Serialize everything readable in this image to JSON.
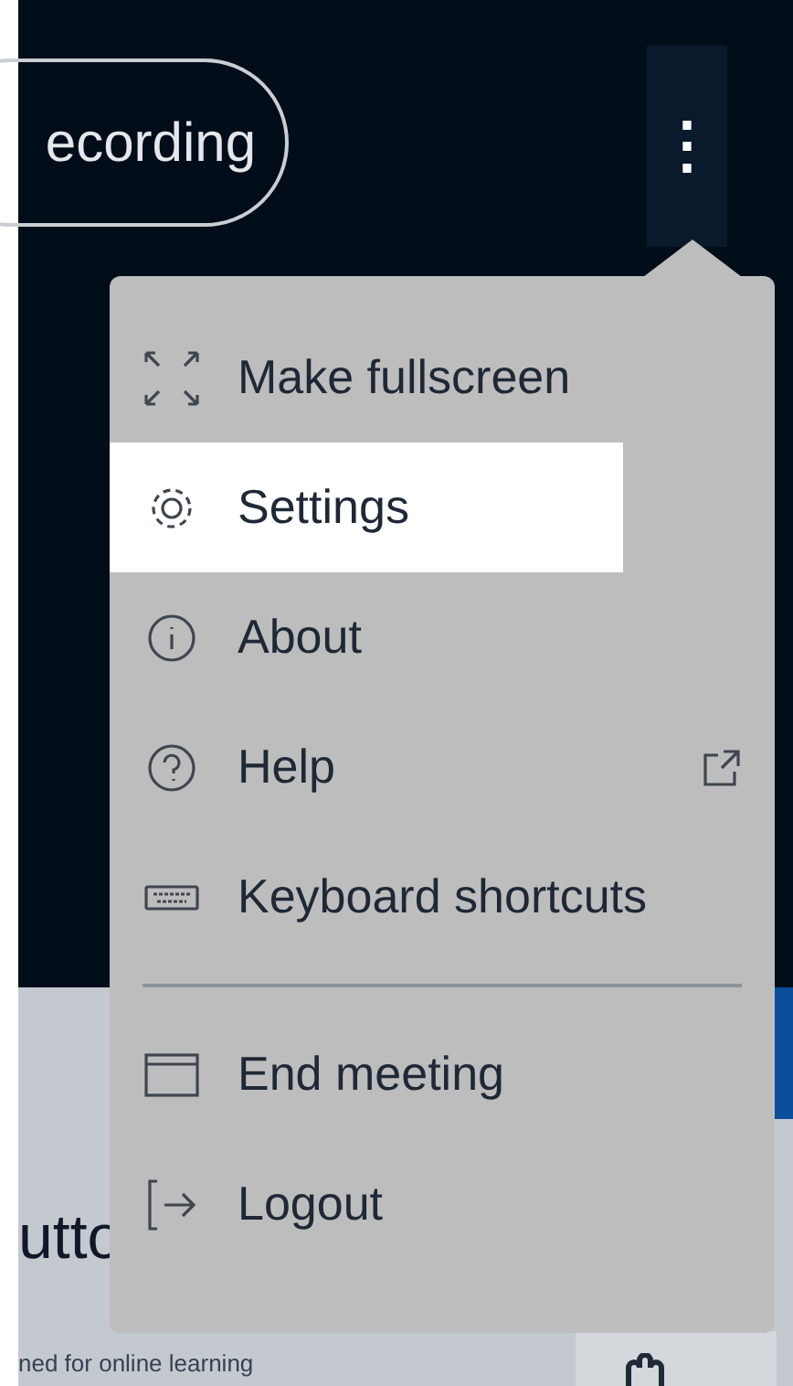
{
  "header": {
    "recording_button": "ecording",
    "more_button": "⋮"
  },
  "menu": {
    "items": [
      {
        "kind": "fullscreen",
        "label": "Make fullscreen",
        "selected": false,
        "external": false
      },
      {
        "kind": "settings",
        "label": "Settings",
        "selected": true,
        "external": false
      },
      {
        "kind": "about",
        "label": "About",
        "selected": false,
        "external": false
      },
      {
        "kind": "help",
        "label": "Help",
        "selected": false,
        "external": true
      },
      {
        "kind": "keyboard",
        "label": "Keyboard shortcuts",
        "selected": false,
        "external": false
      },
      {
        "kind": "divider"
      },
      {
        "kind": "end",
        "label": "End meeting",
        "selected": false,
        "external": false
      },
      {
        "kind": "logout",
        "label": "Logout",
        "selected": false,
        "external": false
      }
    ]
  },
  "background": {
    "title": "utto",
    "subtitle": "ned for online learning"
  }
}
